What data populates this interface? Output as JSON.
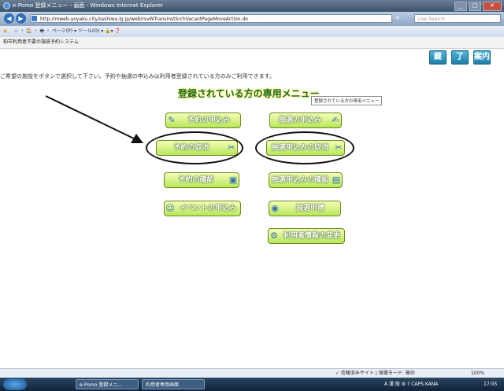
{
  "window": {
    "title": "e-Pomo 登録メニュー - 画面 - Windows Internet Explorer",
    "buttons": {
      "minimize": "_",
      "maximize": "□",
      "close": "✕"
    }
  },
  "browser": {
    "url": "http://mweb-yoyaku.city.kashiwa.lg.jp/web/rsvWTransInstSrchVacantPageMoveAction.do",
    "search_placeholder": "Live Search",
    "addr_tools": "✕",
    "command_bar": "☆ ・ 🏠 ・ 🖶 ・ ページ(P) ▾ ツール(O) ▾ 🔒▾ ❓",
    "page_tab": "柏市利用者不要の施設予約システム"
  },
  "help_buttons": [
    "鍵",
    "了",
    "案内"
  ],
  "instructions": "ご希望の施設をボタンで選択して下さい。予約や抽選の申込みは利用者登録されている方のみご利用できます。",
  "menu_title": "登録されている方の専用メニュー",
  "tooltip": "登録されている方の専用メニュー",
  "menu": {
    "reserve_apply": {
      "label": "予約の申込み",
      "icon": "✎"
    },
    "lottery_apply": {
      "label": "抽選の申込み",
      "icon": "✍"
    },
    "reserve_cancel": {
      "label": "予約の取消",
      "icon": "✂"
    },
    "lottery_cancel": {
      "label": "抽選申込みの取消",
      "icon": "✂"
    },
    "reserve_confirm": {
      "label": "予約の確認",
      "icon": "▣"
    },
    "lottery_confirm": {
      "label": "抽選申込みの確認",
      "icon": "▤"
    },
    "event_apply": {
      "label": "イベントの申込み",
      "icon": "☺"
    },
    "lottery_result": {
      "label": "抽選申請",
      "icon": "◉"
    },
    "user_info": {
      "label": "利用者情報の変更",
      "icon": "⚙"
    }
  },
  "status": {
    "text": "✓ 信頼済みサイト | 保護モード: 無効",
    "zoom": "100%"
  },
  "taskbar": {
    "tasks": [
      "e-Pomo 登録メニ...",
      "利用者専用画面"
    ],
    "tray": "A 漢 般 ⚙ ? CAPS KANA",
    "clock": "17:05"
  },
  "colors": {
    "menu_button": "#b9e65a",
    "menu_title": "#1a6e23",
    "help_button": "#1f7fa8"
  }
}
